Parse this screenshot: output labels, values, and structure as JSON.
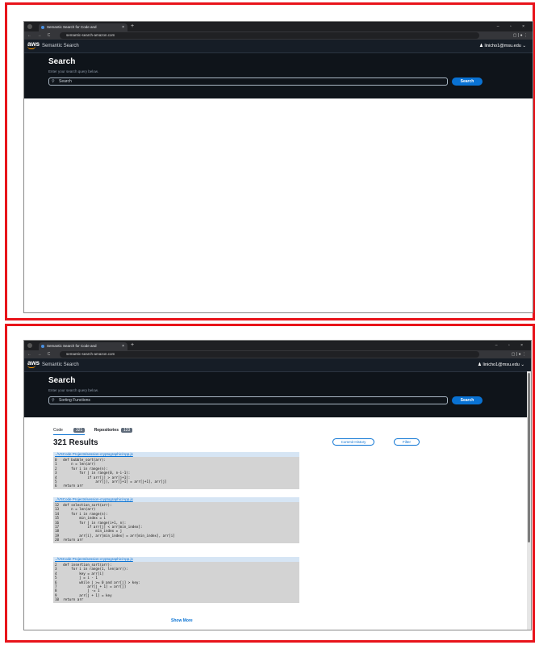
{
  "browser": {
    "tab_title": "Semantic Search for Code and",
    "tab_close": "×",
    "new_tab": "+",
    "url": "semantic-search-amazon.com",
    "window_controls": "– ▫ ×",
    "nav_controls": "← → C",
    "extensions": "▢ | ● ⋮"
  },
  "app": {
    "logo": "aws",
    "title": "Semantic Search",
    "user": "linicho1@msu.edu",
    "heading": "Search",
    "subheading": "Enter your search query below.",
    "search_button": "Search"
  },
  "screen1": {
    "search_value": "Search"
  },
  "screen2": {
    "search_value": "Sorting Functions",
    "tabs": {
      "code_label": "Code",
      "code_count": "321",
      "repos_label": "Repositories",
      "repos_count": "123"
    },
    "results_title": "321 Results",
    "commit_history": "Commit History",
    "filter": "Filter",
    "cards": [
      {
        "path": "../VSCode Projects/session-cryptographic/App.js",
        "code": "0   def bubble_sort(arr):\n1       n = len(arr)\n2       for i in range(n):\n3           for j in range(0, n-i-1):\n4               if arr[j] > arr[j+1]:\n5                   arr[j], arr[j+1] = arr[j+1], arr[j]\n6   return arr"
      },
      {
        "path": "../VSCode Projects/session-cryptographic/App.js",
        "code": "12  def selection_sort(arr):\n13      n = len(arr)\n14      for i in range(n):\n15          min_index = i\n16          for j in range(i+1, n):\n17              if arr[j] < arr[min_index]:\n18                  min_index = j\n19          arr[i], arr[min_index] = arr[min_index], arr[i]\n20  return arr"
      },
      {
        "path": "../VSCode Projects/session-cryptographic/App.js",
        "code": "2   def insertion_sort(arr):\n3       for i in range(1, len(arr)):\n4           key = arr[i]\n5           j = i - 1\n6           while j >= 0 and arr[j] > key:\n7               arr[j + 1] = arr[j]\n8               j -= 1\n9           arr[j + 1] = key\n10  return arr"
      }
    ],
    "show_more": "Show More"
  }
}
